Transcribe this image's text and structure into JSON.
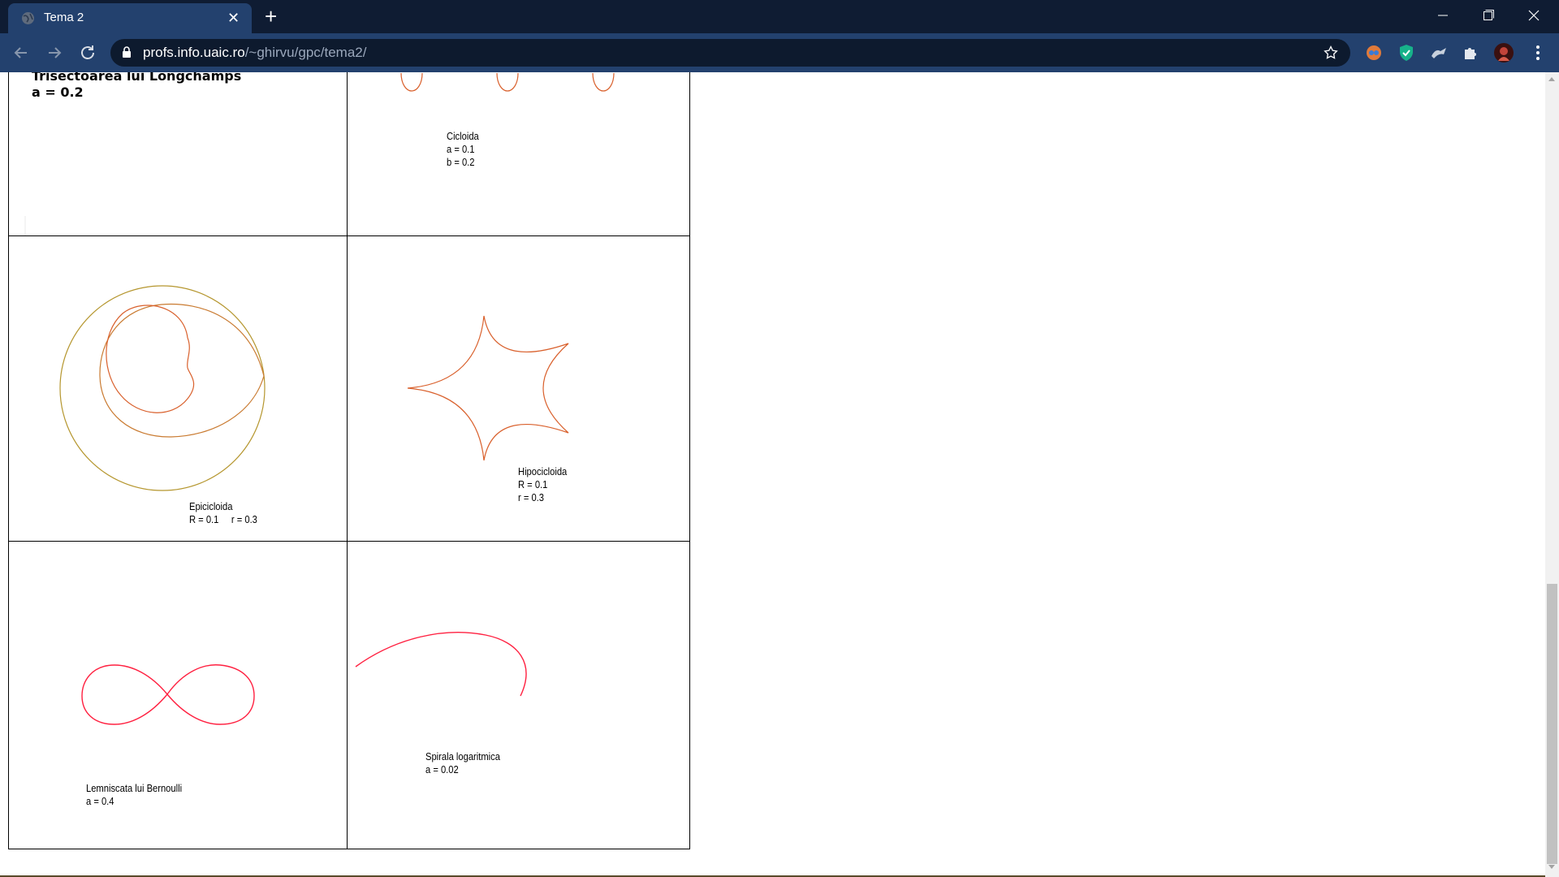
{
  "browser": {
    "tab_title": "Tema 2",
    "tab_close": "✕",
    "new_tab": "+",
    "url_host": "profs.info.uaic.ro",
    "url_path": "/~ghirvu/gpc/tema2/"
  },
  "window_controls": {
    "minimize": "–",
    "restore": "❐",
    "close": "✕"
  },
  "curves": {
    "trisectoarea": {
      "title": "Trisectoarea lui Longchamps",
      "param_a": "a = 0.2"
    },
    "cicloida": {
      "name": "Cicloida",
      "param_a": "a = 0.1",
      "param_b": "b = 0.2"
    },
    "epicicloida": {
      "name": "Epicicloida",
      "param_R": "R = 0.1",
      "param_r": "r = 0.3"
    },
    "hipocicloida": {
      "name": "Hipocicloida",
      "param_R": "R = 0.1",
      "param_r": "r = 0.3"
    },
    "lemniscata": {
      "name": "Lemniscata lui Bernoulli",
      "param_a": "a = 0.4"
    },
    "spirala": {
      "name": "Spirala logaritmica",
      "param_a": "a = 0.02"
    }
  },
  "colors": {
    "chrome_dark": "#0f1c33",
    "chrome_toolbar": "#23416e",
    "curve_orange": "#d9602c",
    "curve_olive": "#b5962e",
    "curve_red": "#ff2040"
  },
  "icons": [
    "globe-icon",
    "close-icon",
    "plus-icon",
    "back-icon",
    "forward-icon",
    "reload-icon",
    "lock-icon",
    "star-icon",
    "extension-icon",
    "puzzle-icon",
    "avatar",
    "menu-icon"
  ]
}
